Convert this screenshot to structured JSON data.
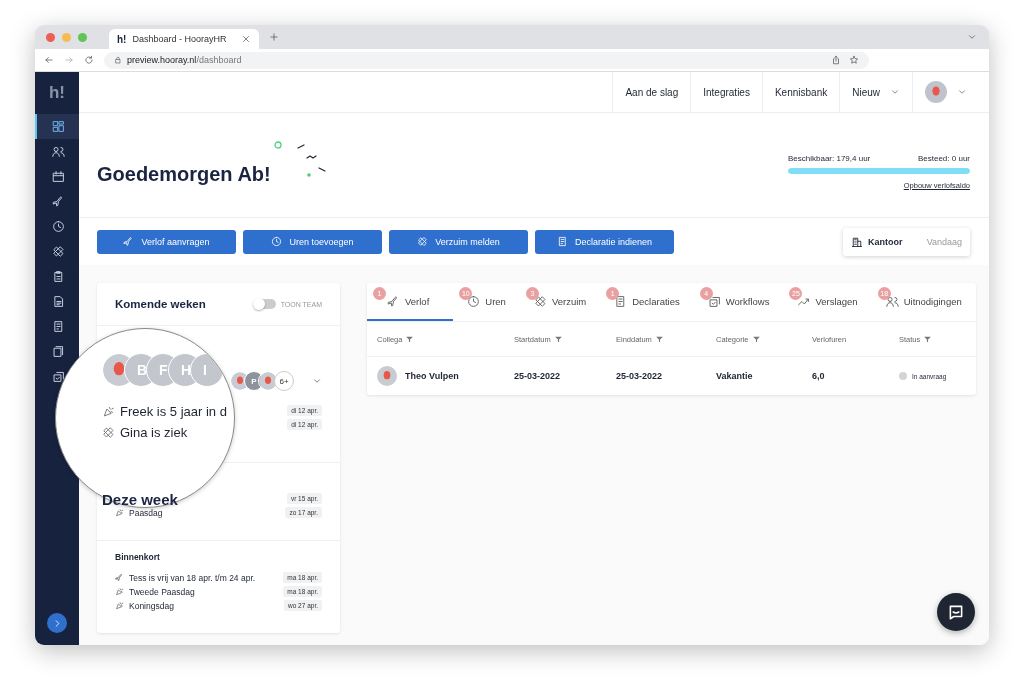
{
  "browser": {
    "tab_favicon": "h!",
    "tab_title": "Dashboard - HoorayHR",
    "url_host": "preview.hooray.nl",
    "url_path": "/dashboard"
  },
  "sidebar": {
    "logo": "h!",
    "items": [
      {
        "kind": "dashboard",
        "selected": true
      },
      {
        "kind": "people",
        "selected": false
      },
      {
        "kind": "calendar",
        "selected": false
      },
      {
        "kind": "plane",
        "selected": false
      },
      {
        "kind": "clock",
        "selected": false
      },
      {
        "kind": "bandage",
        "selected": false
      },
      {
        "kind": "clipboard",
        "selected": false
      },
      {
        "kind": "document",
        "selected": false
      },
      {
        "kind": "receipt",
        "selected": false
      },
      {
        "kind": "files",
        "selected": false
      },
      {
        "kind": "checklist",
        "selected": false
      }
    ]
  },
  "topnav": {
    "items": [
      {
        "label": "Aan de slag",
        "dropdown": false
      },
      {
        "label": "Integraties",
        "dropdown": false
      },
      {
        "label": "Kennisbank",
        "dropdown": false
      },
      {
        "label": "Nieuw",
        "dropdown": true
      }
    ]
  },
  "greeting": "Goedemorgen Ab!",
  "balance": {
    "available": "Beschikbaar: 179,4 uur",
    "spent": "Besteed: 0 uur",
    "level": 1,
    "link": "Opbouw verlofsaldo"
  },
  "actions": [
    {
      "label": "Verlof aanvragen",
      "kind": "plane"
    },
    {
      "label": "Uren toevoegen",
      "kind": "clock"
    },
    {
      "label": "Verzuim melden",
      "kind": "bandage"
    },
    {
      "label": "Declaratie indienen",
      "kind": "receipt"
    }
  ],
  "location": {
    "place": "Kantoor",
    "day": "Vandaag"
  },
  "upcoming": {
    "title": "Komende weken",
    "toggle": {
      "label": "TOON TEAM",
      "on": false
    },
    "magnifier": {
      "avatars": [
        {
          "kind": "face"
        },
        {
          "kind": "initials",
          "initials": "B"
        },
        {
          "kind": "initials",
          "initials": "F"
        },
        {
          "kind": "initials",
          "initials": "H"
        },
        {
          "kind": "initials",
          "initials": "I"
        }
      ],
      "events": [
        {
          "text": "Freek is 5 jaar in d",
          "kind": "party"
        },
        {
          "text": "Gina is ziek",
          "kind": "bandage"
        }
      ],
      "heading": "Deze week"
    },
    "sections": [
      {
        "avatars": [
          {
            "kind": "face"
          },
          {
            "kind": "initials",
            "initials": "P"
          },
          {
            "kind": "face"
          }
        ],
        "more": "6+",
        "events": [
          {
            "date": "di 12 apr."
          },
          {
            "date": "di 12 apr."
          }
        ]
      },
      {
        "events": [
          {
            "date": "vr 15 apr."
          },
          {
            "text": "Paasdag",
            "kind": "party",
            "date": "zo 17 apr."
          }
        ]
      },
      {
        "title": "Binnenkort",
        "events": [
          {
            "text": "Tess is vrij van 18 apr. t/m 24 apr.",
            "kind": "plane",
            "date": "ma 18 apr."
          },
          {
            "text": "Tweede Paasdag",
            "kind": "party",
            "date": "ma 18 apr."
          },
          {
            "text": "Koningsdag",
            "kind": "party",
            "date": "wo 27 apr."
          }
        ]
      }
    ]
  },
  "records": {
    "tabs": [
      {
        "label": "Verlof",
        "count": "1",
        "kind": "plane",
        "selected": true
      },
      {
        "label": "Uren",
        "count": "10",
        "kind": "clock",
        "selected": false
      },
      {
        "label": "Verzuim",
        "count": "3",
        "kind": "bandage",
        "selected": false
      },
      {
        "label": "Declaraties",
        "count": "1",
        "kind": "receipt",
        "selected": false
      },
      {
        "label": "Workflows",
        "count": "4",
        "kind": "checklist",
        "selected": false
      },
      {
        "label": "Verslagen",
        "count": "25",
        "kind": "chart",
        "selected": false
      },
      {
        "label": "Uitnodigingen",
        "count": "18",
        "kind": "people",
        "selected": false
      }
    ],
    "columns": [
      {
        "label": "Collega",
        "filter": true
      },
      {
        "label": "Startdatum",
        "filter": true
      },
      {
        "label": "Einddatum",
        "filter": true
      },
      {
        "label": "Categorie",
        "filter": true
      },
      {
        "label": "Verlofuren",
        "filter": false
      },
      {
        "label": "Status",
        "filter": true
      }
    ],
    "rows": [
      {
        "name": "Theo Vulpen",
        "start": "25-03-2022",
        "end": "25-03-2022",
        "category": "Vakantie",
        "hours": "6,0",
        "status": "In aanvraag",
        "color": "#d4d4d4"
      }
    ]
  }
}
